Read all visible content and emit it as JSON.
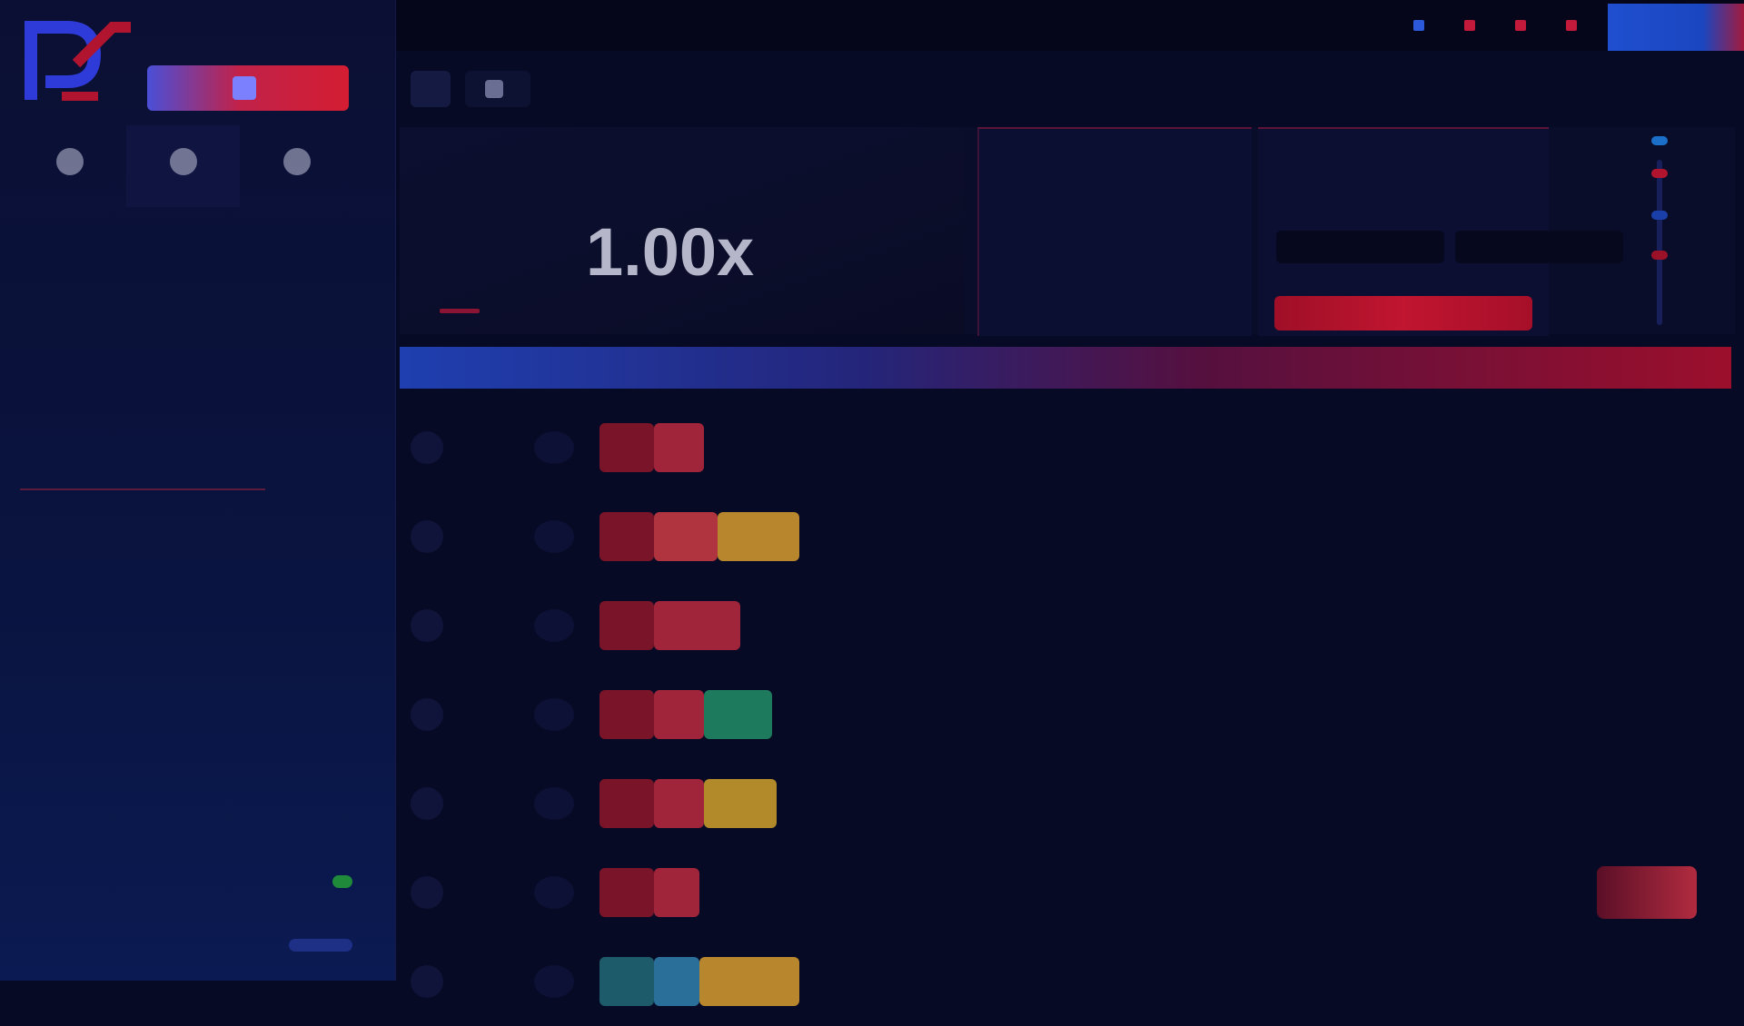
{
  "sidebar": {
    "brand_name": "",
    "promo_label": "",
    "user_actions": [
      {
        "label": "",
        "icon": "user-icon"
      },
      {
        "label": "",
        "icon": "wallet-icon"
      },
      {
        "label": "",
        "icon": "account-icon"
      }
    ],
    "sections": [
      {
        "title": "",
        "subtitle": ""
      },
      {
        "title": "",
        "subtitle": ""
      },
      {
        "title": "",
        "subtitle": ""
      },
      {
        "title": "",
        "subtitle": ""
      },
      {
        "title": "",
        "subtitle": ""
      },
      {
        "title": "",
        "subtitle": ""
      }
    ],
    "footer_1": "",
    "footer_2": ""
  },
  "topbar": {
    "title": "",
    "nav": [
      {
        "label": "",
        "active": true
      },
      {
        "label": "",
        "active": false
      },
      {
        "label": "",
        "active": false
      },
      {
        "label": "",
        "active": false
      }
    ],
    "login_label": ""
  },
  "tabs": [
    {
      "label": "",
      "active": true
    },
    {
      "label": "",
      "active": false
    }
  ],
  "game": {
    "multiplier": "1.00x",
    "bet_labels": [
      "",
      ""
    ],
    "bet_values": [
      "",
      ""
    ],
    "place_bet_label": "",
    "history_title": "",
    "history_colors": [
      "#1b6fc8",
      "#b0142f",
      "#1b3fa8",
      "#9b1228"
    ]
  },
  "banner": {
    "title": "",
    "right_label": ""
  },
  "bets": [
    {
      "user": "",
      "badge_colors": [
        "#7a1428",
        "#a0243a"
      ],
      "badge_widths": [
        60,
        55
      ]
    },
    {
      "user": "",
      "badge_colors": [
        "#7a1428",
        "#b0343f",
        "#b8862c"
      ],
      "badge_widths": [
        60,
        70,
        90
      ]
    },
    {
      "user": "",
      "badge_colors": [
        "#7a1428",
        "#a0243a"
      ],
      "badge_widths": [
        60,
        95
      ]
    },
    {
      "user": "",
      "badge_colors": [
        "#7a1428",
        "#a0243a",
        "#1d7a5c"
      ],
      "badge_widths": [
        60,
        55,
        75
      ]
    },
    {
      "user": "",
      "badge_colors": [
        "#7a1428",
        "#a0243a",
        "#b38a2a"
      ],
      "badge_widths": [
        60,
        55,
        80
      ]
    },
    {
      "user": "",
      "badge_colors": [
        "#7a1428",
        "#a0243a"
      ],
      "badge_widths": [
        60,
        50
      ],
      "mid_value": "",
      "has_right": true
    },
    {
      "user": "",
      "badge_colors": [
        "#1d5a6a",
        "#2a6f9a",
        "#b8862c"
      ],
      "badge_widths": [
        60,
        50,
        110
      ]
    }
  ],
  "colors": {
    "accent_red": "#c11530",
    "accent_blue": "#1f4fcf",
    "bg": "#070a24"
  }
}
